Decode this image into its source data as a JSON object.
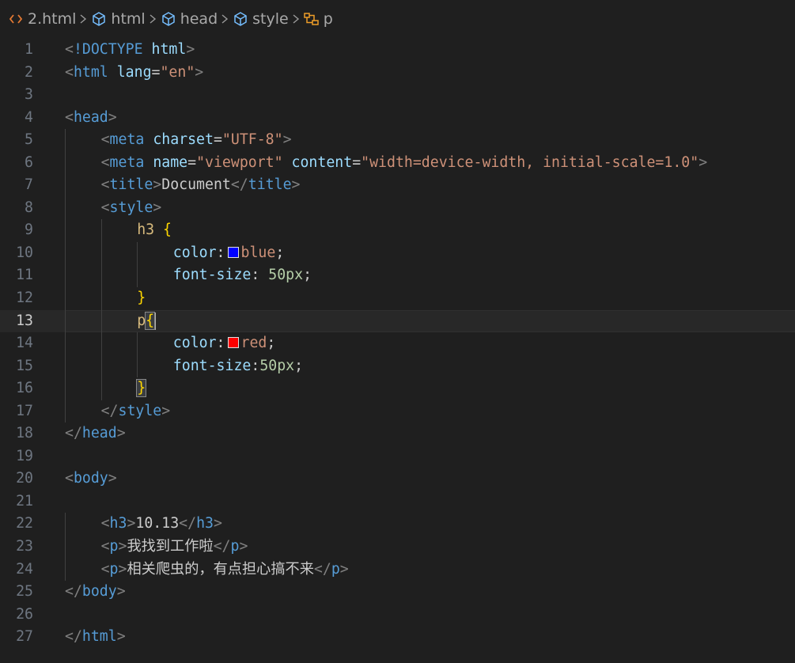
{
  "breadcrumb": [
    {
      "label": "2.html",
      "icon": "html-file-icon",
      "icon_color": "#e37933"
    },
    {
      "label": "html",
      "icon": "cube-icon",
      "icon_color": "#75beff"
    },
    {
      "label": "head",
      "icon": "cube-icon",
      "icon_color": "#75beff"
    },
    {
      "label": "style",
      "icon": "cube-icon",
      "icon_color": "#75beff"
    },
    {
      "label": "p",
      "icon": "css-rule-icon",
      "icon_color": "#ee9d28"
    }
  ],
  "colors": {
    "background": "#1f1f1f",
    "tag": "#569cd6",
    "attribute": "#9cdcfe",
    "string": "#ce9178",
    "selector": "#d7ba7d",
    "brace": "#ffd700",
    "number": "#b5cea8",
    "blue_swatch": "#0000ff",
    "red_swatch": "#ff0000"
  },
  "current_line": 13,
  "lines": [
    {
      "n": "1",
      "indent": 0,
      "tokens": [
        [
          "bracket",
          "<"
        ],
        [
          "tag",
          "!DOCTYPE"
        ],
        [
          "text",
          " "
        ],
        [
          "attr",
          "html"
        ],
        [
          "bracket",
          ">"
        ]
      ]
    },
    {
      "n": "2",
      "indent": 0,
      "tokens": [
        [
          "bracket",
          "<"
        ],
        [
          "tag",
          "html"
        ],
        [
          "text",
          " "
        ],
        [
          "attr",
          "lang"
        ],
        [
          "punct",
          "="
        ],
        [
          "string",
          "\"en\""
        ],
        [
          "bracket",
          ">"
        ]
      ]
    },
    {
      "n": "3",
      "indent": 0,
      "tokens": []
    },
    {
      "n": "4",
      "indent": 0,
      "tokens": [
        [
          "bracket",
          "<"
        ],
        [
          "tag",
          "head"
        ],
        [
          "bracket",
          ">"
        ]
      ]
    },
    {
      "n": "5",
      "indent": 1,
      "tokens": [
        [
          "bracket",
          "<"
        ],
        [
          "tag",
          "meta"
        ],
        [
          "text",
          " "
        ],
        [
          "attr",
          "charset"
        ],
        [
          "punct",
          "="
        ],
        [
          "string",
          "\"UTF-8\""
        ],
        [
          "bracket",
          ">"
        ]
      ]
    },
    {
      "n": "6",
      "indent": 1,
      "tokens": [
        [
          "bracket",
          "<"
        ],
        [
          "tag",
          "meta"
        ],
        [
          "text",
          " "
        ],
        [
          "attr",
          "name"
        ],
        [
          "punct",
          "="
        ],
        [
          "string",
          "\"viewport\""
        ],
        [
          "text",
          " "
        ],
        [
          "attr",
          "content"
        ],
        [
          "punct",
          "="
        ],
        [
          "string",
          "\"width=device-width, initial-scale=1.0\""
        ],
        [
          "bracket",
          ">"
        ]
      ]
    },
    {
      "n": "7",
      "indent": 1,
      "tokens": [
        [
          "bracket",
          "<"
        ],
        [
          "tag",
          "title"
        ],
        [
          "bracket",
          ">"
        ],
        [
          "text",
          "Document"
        ],
        [
          "bracket",
          "</"
        ],
        [
          "tag",
          "title"
        ],
        [
          "bracket",
          ">"
        ]
      ]
    },
    {
      "n": "8",
      "indent": 1,
      "tokens": [
        [
          "bracket",
          "<"
        ],
        [
          "tag",
          "style"
        ],
        [
          "bracket",
          ">"
        ]
      ]
    },
    {
      "n": "9",
      "indent": 2,
      "tokens": [
        [
          "selector",
          "h3"
        ],
        [
          "text",
          " "
        ],
        [
          "brace",
          "{"
        ]
      ]
    },
    {
      "n": "10",
      "indent": 3,
      "tokens": [
        [
          "prop",
          "color"
        ],
        [
          "punct",
          ":"
        ],
        [
          "swatch",
          "blue"
        ],
        [
          "value",
          "blue"
        ],
        [
          "punct",
          ";"
        ]
      ]
    },
    {
      "n": "11",
      "indent": 3,
      "tokens": [
        [
          "prop",
          "font-size"
        ],
        [
          "punct",
          ": "
        ],
        [
          "num",
          "50px"
        ],
        [
          "punct",
          ";"
        ]
      ]
    },
    {
      "n": "12",
      "indent": 2,
      "tokens": [
        [
          "brace",
          "}"
        ]
      ]
    },
    {
      "n": "13",
      "indent": 2,
      "tokens": [
        [
          "selector",
          "p"
        ],
        [
          "bracematch",
          "{"
        ],
        [
          "cursor",
          ""
        ]
      ]
    },
    {
      "n": "14",
      "indent": 3,
      "tokens": [
        [
          "prop",
          "color"
        ],
        [
          "punct",
          ":"
        ],
        [
          "swatch",
          "red"
        ],
        [
          "value",
          "red"
        ],
        [
          "punct",
          ";"
        ]
      ]
    },
    {
      "n": "15",
      "indent": 3,
      "tokens": [
        [
          "prop",
          "font-size"
        ],
        [
          "punct",
          ":"
        ],
        [
          "num",
          "50px"
        ],
        [
          "punct",
          ";"
        ]
      ]
    },
    {
      "n": "16",
      "indent": 2,
      "tokens": [
        [
          "bracematch",
          "}"
        ]
      ]
    },
    {
      "n": "17",
      "indent": 1,
      "tokens": [
        [
          "bracket",
          "</"
        ],
        [
          "tag",
          "style"
        ],
        [
          "bracket",
          ">"
        ]
      ]
    },
    {
      "n": "18",
      "indent": 0,
      "tokens": [
        [
          "bracket",
          "</"
        ],
        [
          "tag",
          "head"
        ],
        [
          "bracket",
          ">"
        ]
      ]
    },
    {
      "n": "19",
      "indent": 0,
      "tokens": []
    },
    {
      "n": "20",
      "indent": 0,
      "tokens": [
        [
          "bracket",
          "<"
        ],
        [
          "tag",
          "body"
        ],
        [
          "bracket",
          ">"
        ]
      ]
    },
    {
      "n": "21",
      "indent": 0,
      "tokens": []
    },
    {
      "n": "22",
      "indent": 1,
      "tokens": [
        [
          "bracket",
          "<"
        ],
        [
          "tag",
          "h3"
        ],
        [
          "bracket",
          ">"
        ],
        [
          "text",
          "10.13"
        ],
        [
          "bracket",
          "</"
        ],
        [
          "tag",
          "h3"
        ],
        [
          "bracket",
          ">"
        ]
      ]
    },
    {
      "n": "23",
      "indent": 1,
      "tokens": [
        [
          "bracket",
          "<"
        ],
        [
          "tag",
          "p"
        ],
        [
          "bracket",
          ">"
        ],
        [
          "text",
          "我找到工作啦"
        ],
        [
          "bracket",
          "</"
        ],
        [
          "tag",
          "p"
        ],
        [
          "bracket",
          ">"
        ]
      ]
    },
    {
      "n": "24",
      "indent": 1,
      "tokens": [
        [
          "bracket",
          "<"
        ],
        [
          "tag",
          "p"
        ],
        [
          "bracket",
          ">"
        ],
        [
          "text",
          "相关爬虫的，有点担心搞不来"
        ],
        [
          "bracket",
          "</"
        ],
        [
          "tag",
          "p"
        ],
        [
          "bracket",
          ">"
        ]
      ]
    },
    {
      "n": "25",
      "indent": 0,
      "tokens": [
        [
          "bracket",
          "</"
        ],
        [
          "tag",
          "body"
        ],
        [
          "bracket",
          ">"
        ]
      ]
    },
    {
      "n": "26",
      "indent": 0,
      "tokens": []
    },
    {
      "n": "27",
      "indent": 0,
      "tokens": [
        [
          "bracket",
          "</"
        ],
        [
          "tag",
          "html"
        ],
        [
          "bracket",
          ">"
        ]
      ]
    }
  ]
}
